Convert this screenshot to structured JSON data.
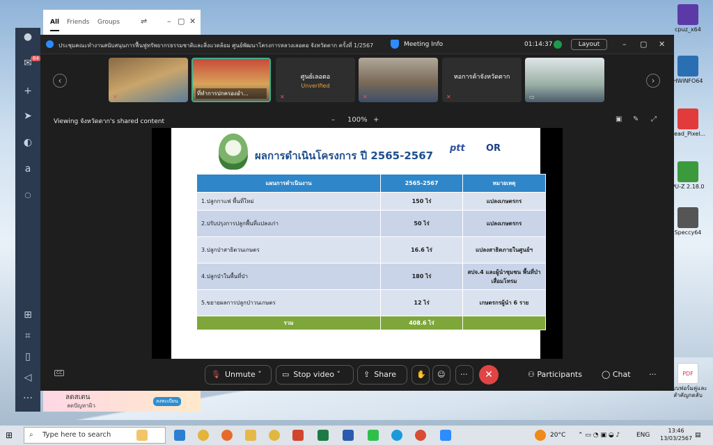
{
  "desktop": {
    "icons_right": [
      {
        "label": "cpuz_x64"
      },
      {
        "label": "HWiNFO64"
      },
      {
        "label": "Read_Pixel..."
      },
      {
        "label": "PU-Z 2.18.0"
      },
      {
        "label": "Speccy64"
      },
      {
        "label": "แบบฟอร์มคู่และ สำคัญกดลับ"
      }
    ]
  },
  "chat_tabs": {
    "tabs": [
      "All",
      "Friends",
      "Groups"
    ]
  },
  "rail": {
    "badge": "64"
  },
  "meeting": {
    "title": "ประชุมคณะทำงานสนับสนุนการฟื้นฟูทรัพยากรธรรมชาติและสิ่งแวดล้อม  ศูนย์พัฒนาโครงการหลวงเลอตอ จังหวัดตาก  ครั้งที่ 1/2567",
    "meeting_info": "Meeting Info",
    "elapsed": "01:14:37",
    "layout_label": "Layout",
    "thumbnails": [
      {
        "caption": ""
      },
      {
        "caption": "ที่ทำการปกครองอำ..."
      },
      {
        "caption": "ศูนย์เลอตอ",
        "status": "Unverified"
      },
      {
        "caption": ""
      },
      {
        "caption": "หอการค้าจังหวัดตาก"
      },
      {
        "caption": ""
      }
    ],
    "viewing_text": "Viewing จังหวัดตาก's shared content",
    "zoom": {
      "minus": "–",
      "level": "100%",
      "plus": "+"
    }
  },
  "slide": {
    "title": "ผลการดำเนินโครงการ ปี 2565-2567",
    "logo_ptt": "ptt",
    "logo_or": "OR",
    "table": {
      "headers": [
        "แผนการดำเนินงาน",
        "2565-2567",
        "หมายเหตุ"
      ],
      "rows": [
        {
          "plan": "1.ปลูกกาแฟ พื้นที่ใหม่",
          "value": "150  ไร่",
          "note": "แปลงเกษตรกร"
        },
        {
          "plan": "2.ปรับปรุงการปลูกพื้นที่แปลงเก่า",
          "value": "50 ไร่",
          "note": "แปลงเกษตรกร"
        },
        {
          "plan": "3.ปลูกป่าสาธิตวนเกษตร",
          "value": "16.6 ไร่",
          "note": "แปลงสาธิตภายในศูนย์ฯ"
        },
        {
          "plan": "4.ปลูกป่าในพื้นที่ป่า",
          "value": "180 ไร่",
          "note": "สปจ.4 และผู้นำชุมชน พื้นที่ป่าเสื่อมโทรม"
        },
        {
          "plan": "5.ขยายผลการปลูกป่าวนเกษตร",
          "value": "12 ไร่",
          "note": "เกษตรกรผู้นำ 6 ราย"
        }
      ],
      "total_label": "รวม",
      "total_value": "408.6 ไร่"
    }
  },
  "toolbar": {
    "unmute": "Unmute",
    "stop_video": "Stop video",
    "share": "Share",
    "participants": "Participants",
    "chat": "Chat",
    "more": "···"
  },
  "ad": {
    "line1": "ลดสเตน",
    "line2": "ลดปัญหาผิว",
    "cta": "ลงทะเบียน"
  },
  "taskbar": {
    "search_placeholder": "Type here to search",
    "weather": "20°C",
    "lang": "ENG",
    "time": "13:46",
    "date": "13/03/2567"
  }
}
